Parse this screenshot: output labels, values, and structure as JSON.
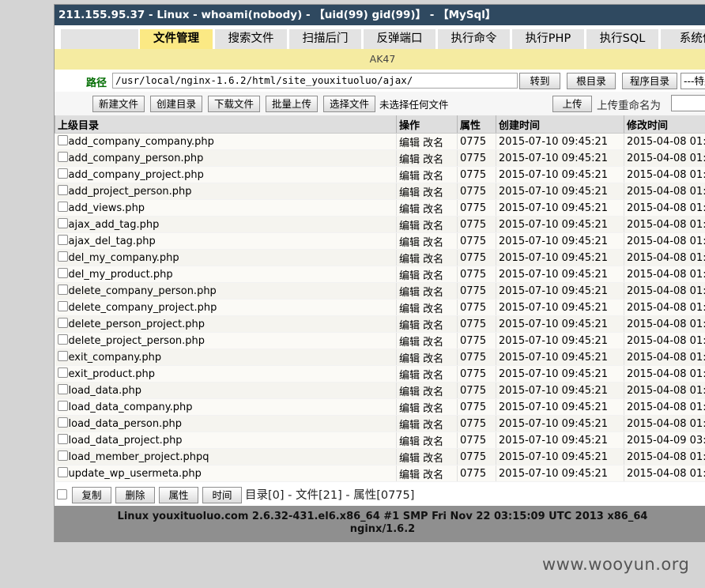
{
  "title": "211.155.95.37 - Linux - whoami(nobody) - 【uid(99) gid(99)】 - 【MySql】",
  "tabs": [
    "文件管理",
    "搜索文件",
    "扫描后门",
    "反弹端口",
    "执行命令",
    "执行PHP",
    "执行SQL",
    "系统信"
  ],
  "ak_label": "AK47",
  "path_label": "路径",
  "path_value": "/usr/local/nginx-1.6.2/html/site_youxituoluo/ajax/",
  "path_buttons": [
    "转到",
    "根目录",
    "程序目录"
  ],
  "select_value": "---特别",
  "actions": [
    "新建文件",
    "创建目录",
    "下载文件",
    "批量上传",
    "选择文件"
  ],
  "no_file": "未选择任何文件",
  "upload_button": "上传",
  "rename_label": "上传重命名为",
  "columns": [
    "上级目录",
    "操作",
    "属性",
    "创建时间",
    "修改时间"
  ],
  "edit_label": "编辑",
  "rename_label_row": "改名",
  "files": [
    {
      "name": "add_company_company.php",
      "perm": "0775",
      "ctime": "2015-07-10 09:45:21",
      "mtime": "2015-04-08 01:"
    },
    {
      "name": "add_company_person.php",
      "perm": "0775",
      "ctime": "2015-07-10 09:45:21",
      "mtime": "2015-04-08 01:"
    },
    {
      "name": "add_company_project.php",
      "perm": "0775",
      "ctime": "2015-07-10 09:45:21",
      "mtime": "2015-04-08 01:"
    },
    {
      "name": "add_project_person.php",
      "perm": "0775",
      "ctime": "2015-07-10 09:45:21",
      "mtime": "2015-04-08 01:"
    },
    {
      "name": "add_views.php",
      "perm": "0775",
      "ctime": "2015-07-10 09:45:21",
      "mtime": "2015-04-08 01:"
    },
    {
      "name": "ajax_add_tag.php",
      "perm": "0775",
      "ctime": "2015-07-10 09:45:21",
      "mtime": "2015-04-08 01:"
    },
    {
      "name": "ajax_del_tag.php",
      "perm": "0775",
      "ctime": "2015-07-10 09:45:21",
      "mtime": "2015-04-08 01:"
    },
    {
      "name": "del_my_company.php",
      "perm": "0775",
      "ctime": "2015-07-10 09:45:21",
      "mtime": "2015-04-08 01:"
    },
    {
      "name": "del_my_product.php",
      "perm": "0775",
      "ctime": "2015-07-10 09:45:21",
      "mtime": "2015-04-08 01:"
    },
    {
      "name": "delete_company_person.php",
      "perm": "0775",
      "ctime": "2015-07-10 09:45:21",
      "mtime": "2015-04-08 01:"
    },
    {
      "name": "delete_company_project.php",
      "perm": "0775",
      "ctime": "2015-07-10 09:45:21",
      "mtime": "2015-04-08 01:"
    },
    {
      "name": "delete_person_project.php",
      "perm": "0775",
      "ctime": "2015-07-10 09:45:21",
      "mtime": "2015-04-08 01:"
    },
    {
      "name": "delete_project_person.php",
      "perm": "0775",
      "ctime": "2015-07-10 09:45:21",
      "mtime": "2015-04-08 01:"
    },
    {
      "name": "exit_company.php",
      "perm": "0775",
      "ctime": "2015-07-10 09:45:21",
      "mtime": "2015-04-08 01:"
    },
    {
      "name": "exit_product.php",
      "perm": "0775",
      "ctime": "2015-07-10 09:45:21",
      "mtime": "2015-04-08 01:"
    },
    {
      "name": "load_data.php",
      "perm": "0775",
      "ctime": "2015-07-10 09:45:21",
      "mtime": "2015-04-08 01:"
    },
    {
      "name": "load_data_company.php",
      "perm": "0775",
      "ctime": "2015-07-10 09:45:21",
      "mtime": "2015-04-08 01:"
    },
    {
      "name": "load_data_person.php",
      "perm": "0775",
      "ctime": "2015-07-10 09:45:21",
      "mtime": "2015-04-08 01:"
    },
    {
      "name": "load_data_project.php",
      "perm": "0775",
      "ctime": "2015-07-10 09:45:21",
      "mtime": "2015-04-09 03:"
    },
    {
      "name": "load_member_project.phpq",
      "perm": "0775",
      "ctime": "2015-07-10 09:45:21",
      "mtime": "2015-04-08 01:"
    },
    {
      "name": "update_wp_usermeta.php",
      "perm": "0775",
      "ctime": "2015-07-10 09:45:21",
      "mtime": "2015-04-08 01:"
    }
  ],
  "bottom_buttons": [
    "复制",
    "删除",
    "属性",
    "时间"
  ],
  "summary": "目录[0] - 文件[21] - 属性[0775]",
  "system_line1": "Linux youxituoluo.com 2.6.32-431.el6.x86_64 #1 SMP Fri Nov 22 03:15:09 UTC 2013 x86_64",
  "system_line2": "nginx/1.6.2",
  "watermark": "www.wooyun.org"
}
